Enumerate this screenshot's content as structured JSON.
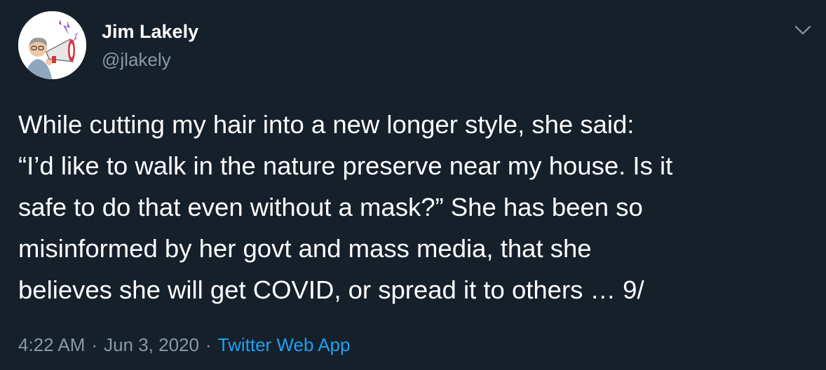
{
  "author": {
    "name": "Jim Lakely",
    "handle": "@jlakely"
  },
  "tweet": {
    "lines": [
      "While cutting my hair into a new longer style, she said:",
      "“I’d like to walk in the nature preserve near my house. Is it",
      "safe to do that even without a mask?” She has been so",
      "misinformed by her govt and mass media, that she",
      "believes she will get COVID, or spread it to others … 9/"
    ]
  },
  "meta": {
    "time": "4:22 AM",
    "separator": "·",
    "date": "Jun 3, 2020",
    "source": "Twitter Web App"
  },
  "icons": {
    "avatar": "megaphone-cartoon-avatar",
    "menu": "chevron-down-icon"
  },
  "colors": {
    "background": "#15202b",
    "primary_text": "#ffffff",
    "secondary_text": "#8899a6",
    "link": "#1da1f2"
  }
}
